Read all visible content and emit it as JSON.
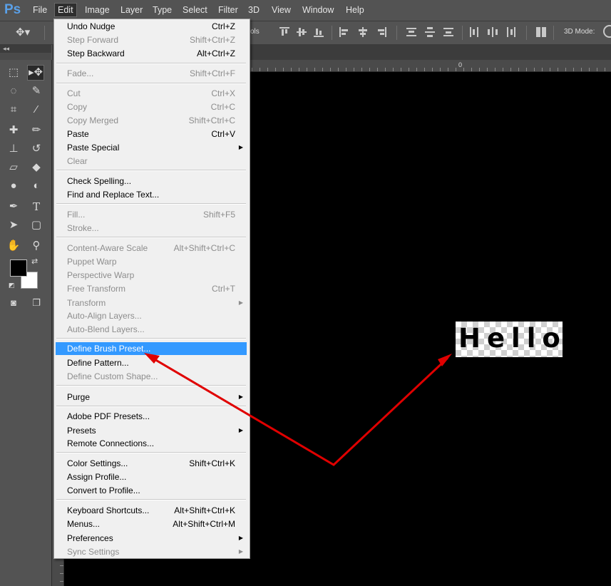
{
  "app": {
    "logo": "Ps"
  },
  "menubar": [
    "File",
    "Edit",
    "Image",
    "Layer",
    "Type",
    "Select",
    "Filter",
    "3D",
    "View",
    "Window",
    "Help"
  ],
  "options_bar": {
    "threed_mode_label": "3D Mode:",
    "truncated_text": "ols"
  },
  "panel": {
    "collapse_glyph": "◂◂"
  },
  "ruler": {
    "zero_label": "0"
  },
  "canvas": {
    "text": "Hello"
  },
  "edit_menu": {
    "undo_nudge": {
      "label": "Undo Nudge",
      "shortcut": "Ctrl+Z"
    },
    "step_forward": {
      "label": "Step Forward",
      "shortcut": "Shift+Ctrl+Z"
    },
    "step_backward": {
      "label": "Step Backward",
      "shortcut": "Alt+Ctrl+Z"
    },
    "fade": {
      "label": "Fade...",
      "shortcut": "Shift+Ctrl+F"
    },
    "cut": {
      "label": "Cut",
      "shortcut": "Ctrl+X"
    },
    "copy": {
      "label": "Copy",
      "shortcut": "Ctrl+C"
    },
    "copy_merged": {
      "label": "Copy Merged",
      "shortcut": "Shift+Ctrl+C"
    },
    "paste": {
      "label": "Paste",
      "shortcut": "Ctrl+V"
    },
    "paste_special": {
      "label": "Paste Special"
    },
    "clear": {
      "label": "Clear"
    },
    "check_spelling": {
      "label": "Check Spelling..."
    },
    "find_replace": {
      "label": "Find and Replace Text..."
    },
    "fill": {
      "label": "Fill...",
      "shortcut": "Shift+F5"
    },
    "stroke": {
      "label": "Stroke..."
    },
    "content_aware_scale": {
      "label": "Content-Aware Scale",
      "shortcut": "Alt+Shift+Ctrl+C"
    },
    "puppet_warp": {
      "label": "Puppet Warp"
    },
    "perspective_warp": {
      "label": "Perspective Warp"
    },
    "free_transform": {
      "label": "Free Transform",
      "shortcut": "Ctrl+T"
    },
    "transform": {
      "label": "Transform"
    },
    "auto_align": {
      "label": "Auto-Align Layers..."
    },
    "auto_blend": {
      "label": "Auto-Blend Layers..."
    },
    "define_brush": {
      "label": "Define Brush Preset..."
    },
    "define_pattern": {
      "label": "Define Pattern..."
    },
    "define_shape": {
      "label": "Define Custom Shape..."
    },
    "purge": {
      "label": "Purge"
    },
    "pdf_presets": {
      "label": "Adobe PDF Presets..."
    },
    "presets": {
      "label": "Presets"
    },
    "remote_connections": {
      "label": "Remote Connections..."
    },
    "color_settings": {
      "label": "Color Settings...",
      "shortcut": "Shift+Ctrl+K"
    },
    "assign_profile": {
      "label": "Assign Profile..."
    },
    "convert_profile": {
      "label": "Convert to Profile..."
    },
    "keyboard_shortcuts": {
      "label": "Keyboard Shortcuts...",
      "shortcut": "Alt+Shift+Ctrl+K"
    },
    "menus": {
      "label": "Menus...",
      "shortcut": "Alt+Shift+Ctrl+M"
    },
    "preferences": {
      "label": "Preferences"
    },
    "sync_settings": {
      "label": "Sync Settings"
    }
  },
  "colors": {
    "highlight": "#3399ff",
    "annotation_arrow": "#e00000",
    "ui_bg": "#535353",
    "canvas_bg": "#000000"
  },
  "icons": [
    "ps-logo",
    "move-tool-icon",
    "marquee-icon",
    "lasso-icon",
    "quick-select-icon",
    "crop-icon",
    "eyedropper-icon",
    "healing-brush-icon",
    "brush-icon",
    "stamp-icon",
    "history-brush-icon",
    "eraser-icon",
    "paint-bucket-icon",
    "blur-icon",
    "dodge-icon",
    "pen-icon",
    "type-icon",
    "path-select-icon",
    "shape-icon",
    "hand-icon",
    "zoom-icon",
    "quick-mask-icon",
    "screen-mode-icon",
    "submenu-arrow-icon"
  ]
}
